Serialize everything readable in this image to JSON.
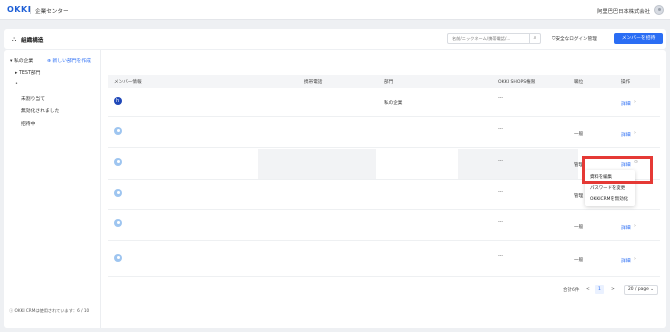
{
  "topbar": {
    "logo": "OKKI",
    "app_title": "企業センター",
    "company": "阿里巴巴日本株式会社"
  },
  "header": {
    "icon": "org-structure-icon",
    "title": "組織構造",
    "search_placeholder": "名前/ニックネーム/携帯電話/...",
    "unsafe_login_label": "安全なログイン管理",
    "invite_label": "メンバーを招待"
  },
  "sidebar": {
    "root_label": "私の企業",
    "new_dept_label": "新しい部門を作成",
    "child_label": "TEST部門",
    "dot": "•",
    "links": [
      "未割り当て",
      "無効化されました",
      "招待中"
    ],
    "footer": "OKKI CRMは使用されています：6 / 10"
  },
  "table": {
    "columns": [
      "メンバー情報",
      "携帯電話",
      "部門",
      "OKKI SHOPS権限",
      "職位",
      "操作"
    ],
    "rows": [
      {
        "dept": "私の企業",
        "shops": "---",
        "position": "",
        "action": "詳細"
      },
      {
        "dept": "",
        "shops": "---",
        "position": "一般",
        "action": "詳細"
      },
      {
        "dept": "",
        "shops": "---",
        "position": "管理",
        "action": "詳細"
      },
      {
        "dept": "",
        "shops": "---",
        "position": "管理",
        "action": "詳細"
      },
      {
        "dept": "",
        "shops": "---",
        "position": "一般",
        "action": "詳細"
      },
      {
        "dept": "",
        "shops": "---",
        "position": "一般",
        "action": "詳細"
      }
    ]
  },
  "dropdown": {
    "items": [
      "資料を編集",
      "パスワードを変更",
      "OKKICRMを無効化"
    ]
  },
  "pagination": {
    "total": "合計6件",
    "prev": "<",
    "current": "1",
    "next": ">",
    "page_size": "20 / page"
  },
  "colors": {
    "accent": "#2a6df4",
    "highlight": "#e53935"
  }
}
